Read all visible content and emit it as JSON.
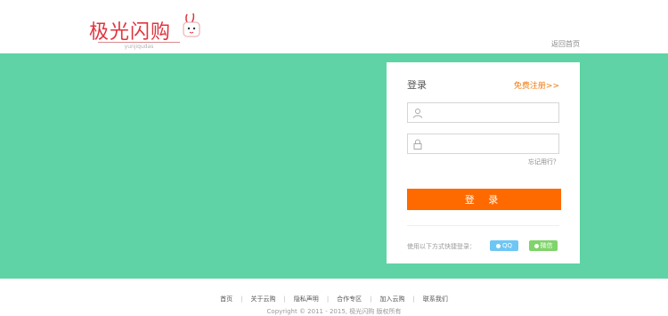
{
  "header": {
    "logo_text": "极光闪购",
    "logo_subtext": "yunjiqudas",
    "top_link": "返回首页"
  },
  "login": {
    "title": "登录",
    "register_link": "免费注册>>",
    "username_placeholder": "",
    "password_placeholder": "",
    "forgot_link": "忘记用行？",
    "submit_label": "登 录",
    "other_methods_label": "使用以下方式快捷登录：",
    "qq_label": "QQ",
    "wechat_label": "微信"
  },
  "footer": {
    "links": [
      "首页",
      "关于云购",
      "隐私声明",
      "合作专区",
      "加入云购",
      "联系我们"
    ],
    "copyright": "Copyright © 2011 - 2015, 极光闪购 版权所有"
  },
  "colors": {
    "band": "#5fd3a5",
    "accent": "#ff6a00",
    "logo": "#e0353f",
    "qq": "#6ec6f5",
    "wechat": "#7fd46a"
  }
}
